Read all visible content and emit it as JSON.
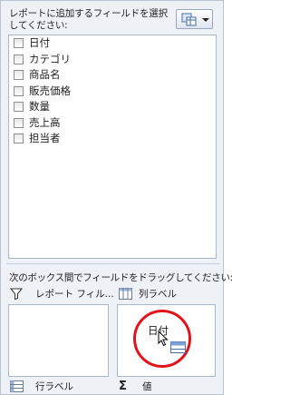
{
  "header": {
    "instruction": "レポートに追加するフィールドを選択してください:",
    "layout_button_icon": "field-list-layout-icon"
  },
  "fields": [
    {
      "label": "日付",
      "checked": false
    },
    {
      "label": "カテゴリ",
      "checked": false
    },
    {
      "label": "商品名",
      "checked": false
    },
    {
      "label": "販売価格",
      "checked": false
    },
    {
      "label": "数量",
      "checked": false
    },
    {
      "label": "売上高",
      "checked": false
    },
    {
      "label": "担当者",
      "checked": false
    }
  ],
  "areas": {
    "instruction": "次のボックス間でフィールドをドラッグしてください:",
    "report_filter": {
      "label": "レポート フィル...",
      "icon": "filter-icon"
    },
    "column_labels": {
      "label": "列ラベル",
      "icon": "columns-icon",
      "drag_field": "日付"
    },
    "row_labels": {
      "label": "行ラベル",
      "icon": "rows-icon"
    },
    "values": {
      "label": "値",
      "icon": "sigma-icon"
    }
  },
  "colors": {
    "highlight_ring": "#e0141a",
    "pane_bg": "#eef1f6"
  }
}
